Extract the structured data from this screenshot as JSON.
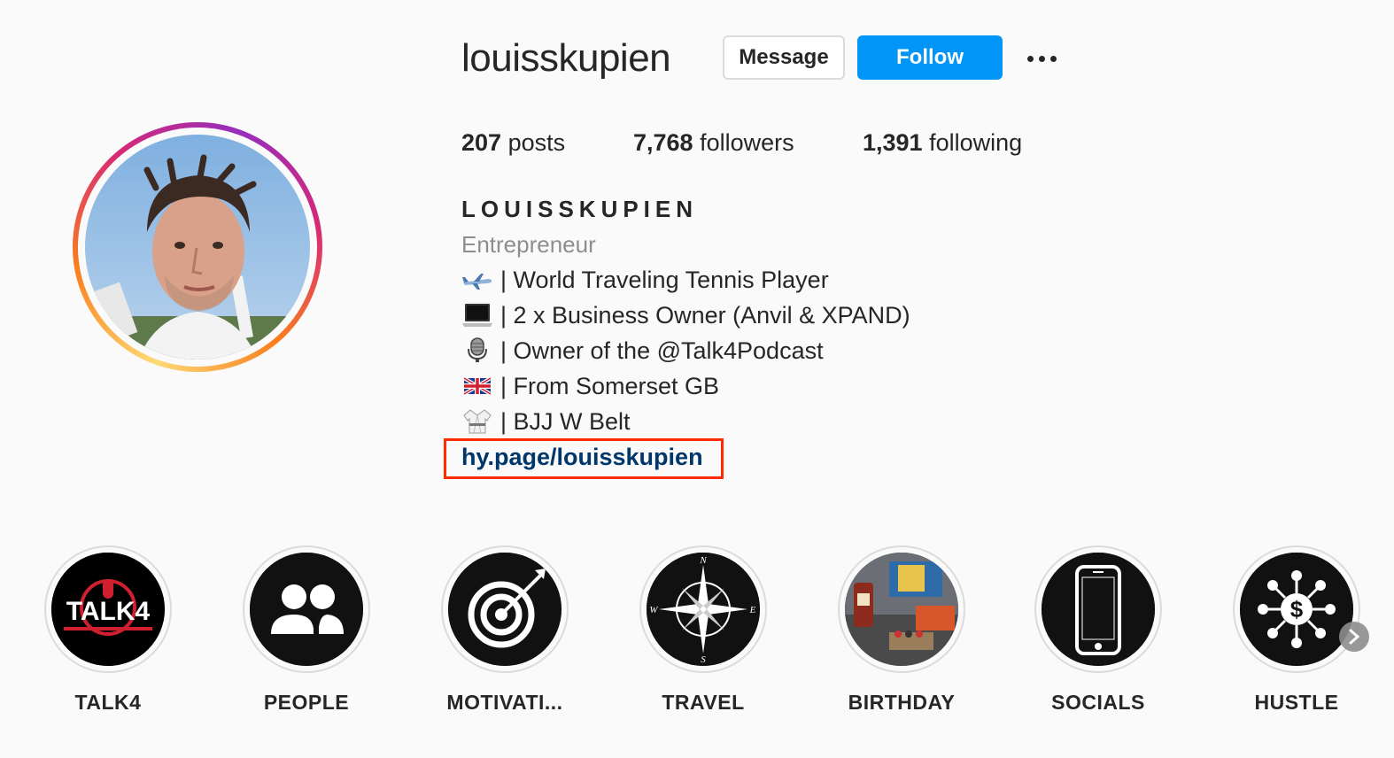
{
  "profile": {
    "username": "louisskupien",
    "message_label": "Message",
    "follow_label": "Follow",
    "stats": {
      "posts_count": "207",
      "posts_label": "posts",
      "followers_count": "7,768",
      "followers_label": "followers",
      "following_count": "1,391",
      "following_label": "following"
    },
    "bio": {
      "name": "LOUISSKUPIEN",
      "category": "Entrepreneur",
      "lines": [
        {
          "icon": "airplane-icon",
          "text": "| World Traveling Tennis Player"
        },
        {
          "icon": "laptop-icon",
          "text": "| 2 x Business Owner (Anvil & XPAND)"
        },
        {
          "icon": "microphone-icon",
          "text": "| Owner of the @Talk4Podcast"
        },
        {
          "icon": "uk-flag-icon",
          "text": "| From Somerset GB"
        },
        {
          "icon": "martial-arts-uniform-icon",
          "text": "| BJJ W Belt"
        }
      ],
      "link": "hy.page/louisskupien"
    }
  },
  "highlights": [
    {
      "label": "TALK4",
      "icon": "talk4-logo",
      "logo_text": "TALK4"
    },
    {
      "label": "PEOPLE",
      "icon": "people-icon"
    },
    {
      "label": "MOTIVATI...",
      "icon": "target-icon"
    },
    {
      "label": "TRAVEL",
      "icon": "compass-icon",
      "compass": {
        "n": "N",
        "e": "E",
        "s": "S",
        "w": "W"
      }
    },
    {
      "label": "BIRTHDAY",
      "icon": "photo-thumbnail"
    },
    {
      "label": "SOCIALS",
      "icon": "phone-icon"
    },
    {
      "label": "HUSTLE",
      "icon": "dollar-network-icon"
    }
  ],
  "colors": {
    "follow_blue": "#0095f6",
    "link_blue": "#00376b",
    "annotation_red": "#ff2a00",
    "secondary_text": "#8e8e8e"
  }
}
